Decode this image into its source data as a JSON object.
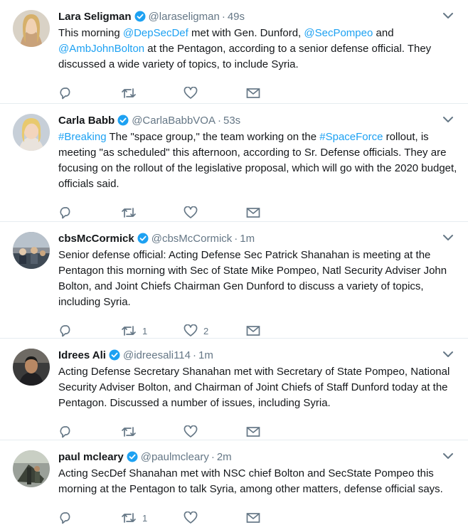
{
  "tweets": [
    {
      "name": "Lara Seligman",
      "handle": "@laraseligman",
      "time": "49s",
      "segments": [
        {
          "t": "This morning "
        },
        {
          "t": "@DepSecDef",
          "link": true
        },
        {
          "t": " met with Gen. Dunford, "
        },
        {
          "t": "@SecPompeo",
          "link": true
        },
        {
          "t": " and "
        },
        {
          "t": "@AmbJohnBolton",
          "link": true
        },
        {
          "t": " at the Pentagon, according to a senior defense official. They discussed a wide variety of topics, to include Syria."
        }
      ],
      "counts": {
        "reply": "",
        "retweet": "",
        "like": ""
      }
    },
    {
      "name": "Carla Babb",
      "handle": "@CarlaBabbVOA",
      "time": "53s",
      "segments": [
        {
          "t": "#Breaking",
          "link": true
        },
        {
          "t": " The \"space group,\" the team working on the "
        },
        {
          "t": "#SpaceForce",
          "link": true
        },
        {
          "t": " rollout, is meeting \"as scheduled\" this afternoon, according to Sr. Defense officials. They are focusing on the rollout of the legislative proposal, which will go with the 2020 budget, officials said."
        }
      ],
      "counts": {
        "reply": "",
        "retweet": "",
        "like": ""
      }
    },
    {
      "name": "cbsMcCormick",
      "handle": "@cbsMcCormick",
      "time": "1m",
      "segments": [
        {
          "t": "Senior defense official: Acting Defense Sec Patrick Shanahan is meeting at the Pentagon this morning with Sec of State Mike Pompeo, Natl Security Adviser John Bolton, and Joint Chiefs Chairman Gen Dunford to discuss a variety of topics, including Syria."
        }
      ],
      "counts": {
        "reply": "",
        "retweet": "1",
        "like": "2"
      }
    },
    {
      "name": "Idrees Ali",
      "handle": "@idreesali114",
      "time": "1m",
      "segments": [
        {
          "t": "Acting Defense Secretary Shanahan met with Secretary of State Pompeo, National Security Adviser Bolton, and Chairman of Joint Chiefs of Staff Dunford today at the Pentagon. Discussed a number of issues, including Syria."
        }
      ],
      "counts": {
        "reply": "",
        "retweet": "",
        "like": ""
      }
    },
    {
      "name": "paul mcleary",
      "handle": "@paulmcleary",
      "time": "2m",
      "segments": [
        {
          "t": "Acting SecDef Shanahan met with NSC chief Bolton and SecState Pompeo this morning at the Pentagon to talk Syria, among other matters, defense official says."
        }
      ],
      "counts": {
        "reply": "",
        "retweet": "1",
        "like": ""
      }
    }
  ],
  "separator": "·",
  "colors": {
    "link": "#1da1f2",
    "verified": "#1da1f2",
    "muted": "#657786",
    "border": "#e6ecf0"
  },
  "icons": {
    "verified": "verified-badge-icon",
    "caret": "chevron-down-icon",
    "reply": "reply-icon",
    "retweet": "retweet-icon",
    "like": "heart-icon",
    "dm": "envelope-icon"
  }
}
